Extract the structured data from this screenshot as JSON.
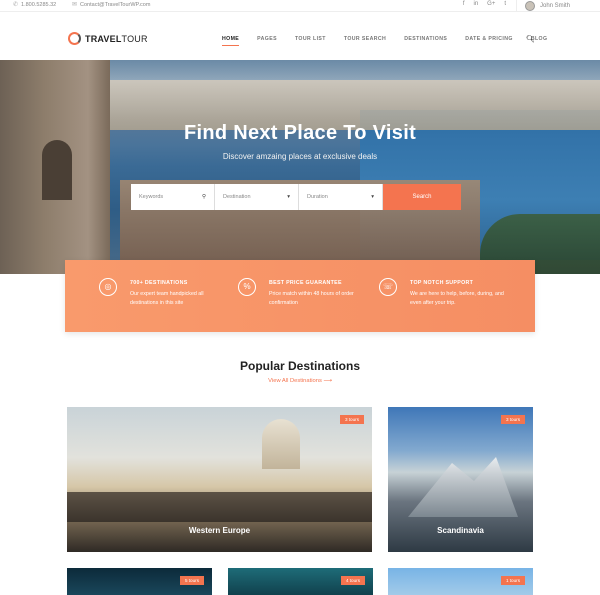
{
  "topbar": {
    "phone": "1.800.5285.32",
    "email": "Contact@TravelTourWP.com",
    "social": [
      "f",
      "in",
      "G+",
      "t"
    ],
    "user_name": "John Smith"
  },
  "nav": {
    "logo_main": "TRAVEL",
    "logo_sub": "TOUR",
    "items": [
      "HOME",
      "PAGES",
      "TOUR LIST",
      "TOUR SEARCH",
      "DESTINATIONS",
      "DATE & PRICING",
      "BLOG"
    ],
    "active": "HOME"
  },
  "hero": {
    "title": "Find Next Place To Visit",
    "subtitle": "Discover amzaing places at exclusive deals"
  },
  "search": {
    "keywords_placeholder": "Keywords",
    "destination_placeholder": "Destination",
    "duration_placeholder": "Duration",
    "button_label": "Search"
  },
  "features": [
    {
      "title": "700+ DESTINATIONS",
      "text": "Our expert team handpicked all destinations in this site",
      "icon": "globe-icon"
    },
    {
      "title": "BEST PRICE GUARANTEE",
      "text": "Price match within 48 hours of order confirmation",
      "icon": "percent-icon"
    },
    {
      "title": "TOP NOTCH SUPPORT",
      "text": "We are here to help, before, during, and even after your trip.",
      "icon": "support-icon"
    }
  ],
  "popular": {
    "title": "Popular Destinations",
    "link": "View All Destinations",
    "cards": [
      {
        "name": "Western Europe",
        "badge": "3 tours"
      },
      {
        "name": "Scandinavia",
        "badge": "3 tours"
      },
      {
        "name": "",
        "badge": "5 tours"
      },
      {
        "name": "",
        "badge": "4 tours"
      },
      {
        "name": "",
        "badge": "1 tours"
      }
    ]
  },
  "colors": {
    "accent": "#f4744f"
  }
}
